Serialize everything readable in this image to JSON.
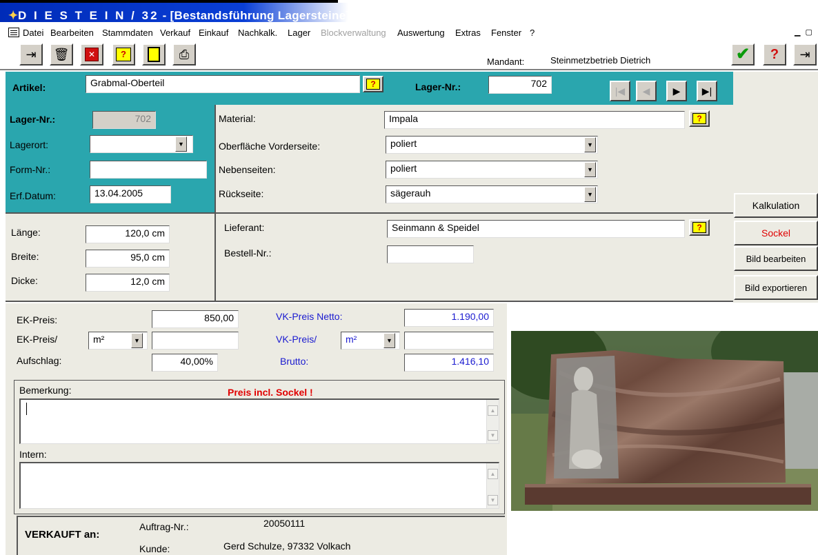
{
  "window": {
    "title_prefix": "D I E S T E I N / 32",
    "title_suffix": " - [Bestandsführung Lagersteine]"
  },
  "menu": [
    {
      "label": "Datei",
      "enabled": true
    },
    {
      "label": "Bearbeiten",
      "enabled": true
    },
    {
      "label": "Stammdaten",
      "enabled": true
    },
    {
      "label": "Verkauf",
      "enabled": true
    },
    {
      "label": "Einkauf",
      "enabled": true
    },
    {
      "label": "Nachkalk.",
      "enabled": true
    },
    {
      "label": "Lager",
      "enabled": true
    },
    {
      "label": "Blockverwaltung",
      "enabled": false
    },
    {
      "label": "Auswertung",
      "enabled": true
    },
    {
      "label": "Extras",
      "enabled": true
    },
    {
      "label": "Fenster",
      "enabled": true
    },
    {
      "label": "?",
      "enabled": true
    }
  ],
  "toolbar": {
    "mandant_label": "Mandant:",
    "mandant_value": "Steinmetzbetrieb Dietrich",
    "buttons": [
      "add-record-icon",
      "delete-record-icon",
      "remove-record-icon",
      "search-icon",
      "clipboard-icon",
      "print-icon"
    ],
    "right_buttons": [
      "ok-check-icon",
      "help-icon",
      "exit-door-icon"
    ]
  },
  "header": {
    "artikel_label": "Artikel:",
    "artikel_value": "Grabmal-Oberteil",
    "lager_nr_label": "Lager-Nr.:",
    "lager_nr_value": "702"
  },
  "stock": {
    "lager_nr_label": "Lager-Nr.:",
    "lager_nr_value": "702",
    "lagerort_label": "Lagerort:",
    "lagerort_value": "",
    "form_nr_label": "Form-Nr.:",
    "form_nr_value": "",
    "erf_datum_label": "Erf.Datum:",
    "erf_datum_value": "13.04.2005"
  },
  "material": {
    "material_label": "Material:",
    "material_value": "Impala",
    "vorderseite_label": "Oberfläche Vorderseite:",
    "vorderseite_value": "poliert",
    "nebenseiten_label": "Nebenseiten:",
    "nebenseiten_value": "poliert",
    "rueckseite_label": "Rückseite:",
    "rueckseite_value": "sägerauh"
  },
  "dimensions": {
    "laenge_label": "Länge:",
    "laenge_value": "120,0 cm",
    "breite_label": "Breite:",
    "breite_value": "95,0 cm",
    "dicke_label": "Dicke:",
    "dicke_value": "12,0 cm"
  },
  "supplier": {
    "lieferant_label": "Lieferant:",
    "lieferant_value": "Seinmann & Speidel",
    "bestell_nr_label": "Bestell-Nr.:",
    "bestell_nr_value": ""
  },
  "side_buttons": {
    "kalkulation": "Kalkulation",
    "sockel": "Sockel",
    "bild_bearbeiten": "Bild bearbeiten",
    "bild_exportieren": "Bild exportieren"
  },
  "pricing": {
    "ek_preis_label": "EK-Preis:",
    "ek_preis_value": "850,00",
    "ek_preis_per_label": "EK-Preis/",
    "ek_unit": "m²",
    "ek_per_value": "",
    "aufschlag_label": "Aufschlag:",
    "aufschlag_value": "40,00%",
    "vk_netto_label": "VK-Preis Netto:",
    "vk_netto_value": "1.190,00",
    "vk_per_label": "VK-Preis/",
    "vk_unit": "m²",
    "vk_per_value": "",
    "brutto_label": "Brutto:",
    "brutto_value": "1.416,10"
  },
  "notes": {
    "bemerkung_label": "Bemerkung:",
    "bemerkung_hint": "Preis incl. Sockel !",
    "bemerkung_value": "",
    "intern_label": "Intern:",
    "intern_value": ""
  },
  "sold": {
    "heading": "VERKAUFT an:",
    "auftrag_label": "Auftrag-Nr.:",
    "auftrag_value": "20050111",
    "kunde_label": "Kunde:",
    "kunde_value": "Gerd Schulze, 97332 Volkach"
  },
  "colors": {
    "teal_panel": "#2aa6ae",
    "form_bg": "#ecebe3",
    "title_blue": "#002bb8",
    "price_blue": "#1a1ad0",
    "warning_red": "#e00000"
  }
}
